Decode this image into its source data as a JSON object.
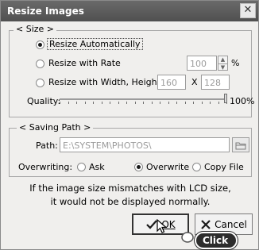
{
  "window": {
    "title": "Resize Images"
  },
  "size_group": {
    "legend": "< Size >",
    "resize_auto": "Resize Automatically",
    "resize_rate": "Resize with Rate",
    "rate_value": "100",
    "rate_unit": "%",
    "resize_wh": "Resize with Width, Height",
    "width_value": "160",
    "x_sep": "X",
    "height_value": "128",
    "quality_label": "Quality:",
    "quality_value": "100%",
    "quality_level": 1.0,
    "selected": "resize_auto"
  },
  "saving_group": {
    "legend": "< Saving Path >",
    "path_label": "Path:",
    "path_value": "E:\\SYSTEM\\PHOTOS\\",
    "overwriting_label": "Overwriting:",
    "ask": "Ask",
    "overwrite": "Overwrite",
    "copy_file": "Copy File",
    "selected": "overwrite"
  },
  "message": {
    "line1": "If the image size mismatches with LCD size,",
    "line2": "it would not be displayed normally."
  },
  "buttons": {
    "ok": "OK",
    "cancel": "Cancel"
  },
  "annotation": {
    "click": "Click"
  }
}
